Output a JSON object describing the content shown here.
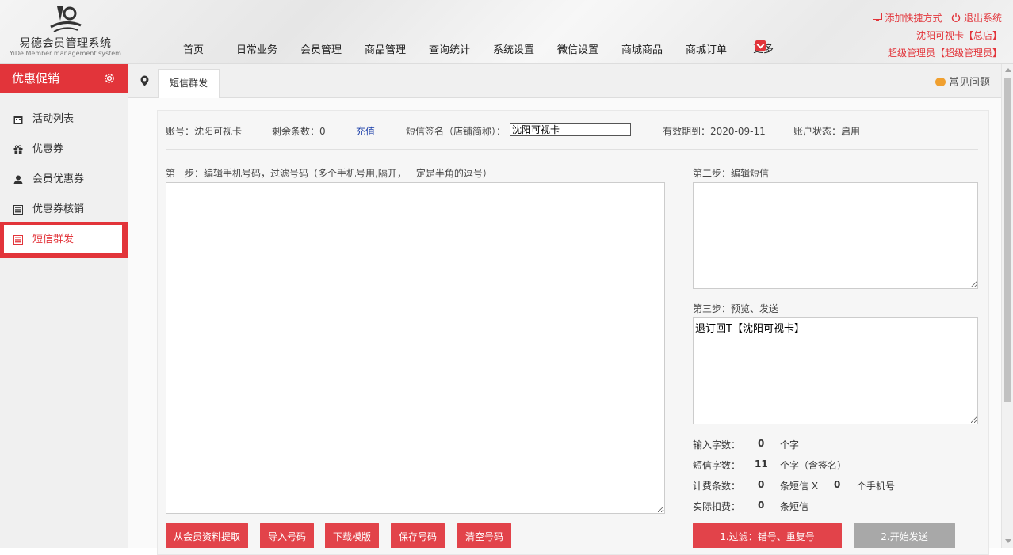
{
  "header": {
    "logo_name": "易德会员管理系统",
    "logo_sub": "YiDe Member management system",
    "nav": [
      "首页",
      "日常业务",
      "会员管理",
      "商品管理",
      "查询统计",
      "系统设置",
      "微信设置",
      "商城商品",
      "商城订单"
    ],
    "more": "更多",
    "add_shortcut": "添加快捷方式",
    "logout": "退出系统",
    "store": "沈阳可视卡【总店】",
    "admin": "超级管理员【超级管理员】"
  },
  "sidebar": {
    "title": "优惠促销",
    "items": [
      {
        "label": "活动列表",
        "icon": "calendar-icon"
      },
      {
        "label": "优惠券",
        "icon": "gift-icon"
      },
      {
        "label": "会员优惠券",
        "icon": "user-icon"
      },
      {
        "label": "优惠券核销",
        "icon": "list-icon"
      },
      {
        "label": "短信群发",
        "icon": "list-icon"
      }
    ],
    "active_index": 4
  },
  "tabs": {
    "current": "短信群发",
    "faq": "常见问题"
  },
  "info": {
    "account": "账号：沈阳可视卡",
    "remaining": "剩余条数：0",
    "recharge": "充值",
    "sign_label": "短信签名（店铺简称）：",
    "sign_value": "沈阳可视卡",
    "expiry": "有效期到：2020-09-11",
    "status": "账户状态：启用"
  },
  "step1": {
    "label": "第一步：编辑手机号码，过滤号码（多个手机号用,隔开，一定是半角的逗号）",
    "value": ""
  },
  "step2": {
    "label": "第二步：编辑短信",
    "value": ""
  },
  "step3": {
    "label": "第三步：预览、发送",
    "value": "退订回T【沈阳可视卡】"
  },
  "stats": {
    "input_label": "输入字数：",
    "input_value": "0",
    "input_unit": "个字",
    "sms_label": "短信字数：",
    "sms_value": "11",
    "sms_unit": "个字（含签名）",
    "billing_label": "计费条数：",
    "billing_value": "0",
    "billing_unit": "条短信 X",
    "phones_value": "0",
    "phones_unit": "个手机号",
    "actual_label": "实际扣费：",
    "actual_value": "0",
    "actual_unit": "条短信"
  },
  "buttons": {
    "extract": "从会员资料提取",
    "import": "导入号码",
    "download": "下载模版",
    "save": "保存号码",
    "clear": "清空号码",
    "filter": "1.过滤：错号、重复号",
    "send": "2.开始发送"
  },
  "colors": {
    "accent": "#e2343a",
    "button_grey": "#a8a8a8"
  }
}
